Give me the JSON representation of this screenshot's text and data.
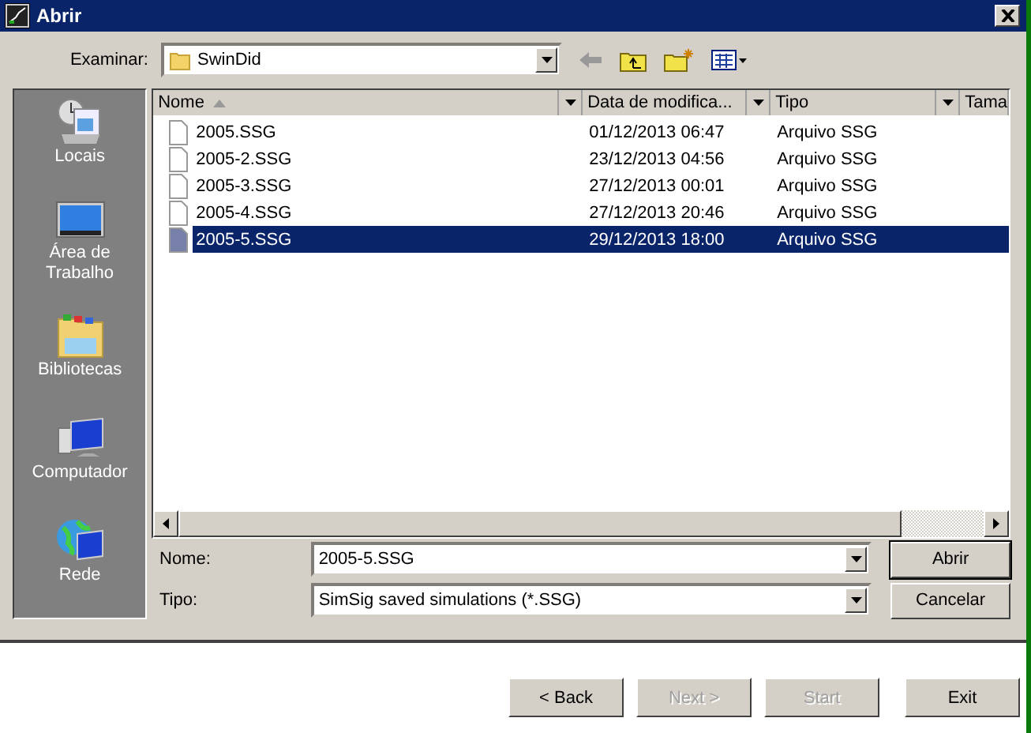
{
  "window": {
    "title": "Abrir"
  },
  "toolbar": {
    "look_in_label": "Examinar:",
    "folder": "SwinDid"
  },
  "places": [
    {
      "label": "Locais",
      "kind": "recent"
    },
    {
      "label": "Área de Trabalho",
      "kind": "desktop"
    },
    {
      "label": "Bibliotecas",
      "kind": "libraries"
    },
    {
      "label": "Computador",
      "kind": "computer"
    },
    {
      "label": "Rede",
      "kind": "network"
    }
  ],
  "table": {
    "columns": [
      "Nome",
      "Data de modifica...",
      "Tipo",
      "Tama"
    ],
    "rows": [
      {
        "name": "2005.SSG",
        "date": "01/12/2013 06:47",
        "type": "Arquivo SSG",
        "selected": false
      },
      {
        "name": "2005-2.SSG",
        "date": "23/12/2013 04:56",
        "type": "Arquivo SSG",
        "selected": false
      },
      {
        "name": "2005-3.SSG",
        "date": "27/12/2013 00:01",
        "type": "Arquivo SSG",
        "selected": false
      },
      {
        "name": "2005-4.SSG",
        "date": "27/12/2013 20:46",
        "type": "Arquivo SSG",
        "selected": false
      },
      {
        "name": "2005-5.SSG",
        "date": "29/12/2013 18:00",
        "type": "Arquivo SSG",
        "selected": true
      }
    ]
  },
  "filename": {
    "label": "Nome:",
    "value": "2005-5.SSG"
  },
  "filetype": {
    "label": "Tipo:",
    "value": "SimSig saved simulations (*.SSG)"
  },
  "dialog_buttons": [
    "Abrir",
    "Cancelar"
  ],
  "wizard_buttons": [
    {
      "label": "< Back",
      "disabled": false
    },
    {
      "label": "Next >",
      "disabled": true
    },
    {
      "label": "Start",
      "disabled": true
    },
    {
      "label": "Exit",
      "disabled": false
    }
  ]
}
